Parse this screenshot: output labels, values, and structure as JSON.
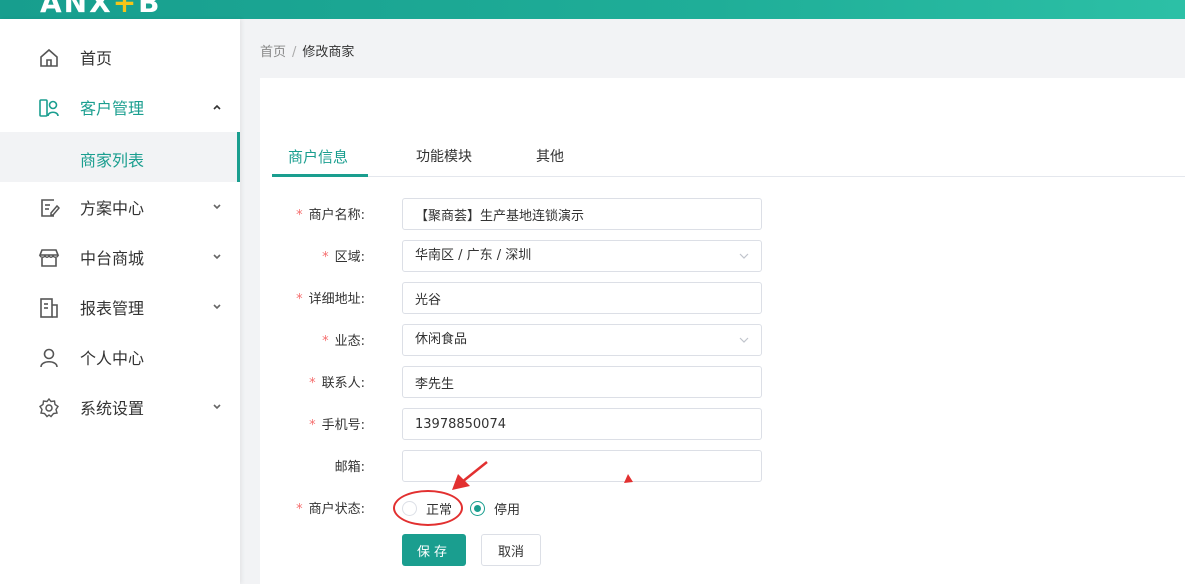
{
  "header": {
    "logo_main": "ANX",
    "logo_plus": "+",
    "logo_tail": "B"
  },
  "sidebar": {
    "items": [
      {
        "label": "首页",
        "icon": "home-icon"
      },
      {
        "label": "客户管理",
        "icon": "customer-icon",
        "expanded": true,
        "children": [
          {
            "label": "商家列表",
            "active": true
          }
        ]
      },
      {
        "label": "方案中心",
        "icon": "plan-icon"
      },
      {
        "label": "中台商城",
        "icon": "store-icon"
      },
      {
        "label": "报表管理",
        "icon": "report-icon"
      },
      {
        "label": "个人中心",
        "icon": "user-icon"
      },
      {
        "label": "系统设置",
        "icon": "settings-icon"
      }
    ]
  },
  "breadcrumb": {
    "home": "首页",
    "separator": "/",
    "current": "修改商家"
  },
  "tabs": [
    {
      "label": "商户信息",
      "active": true
    },
    {
      "label": "功能模块"
    },
    {
      "label": "其他"
    }
  ],
  "form": {
    "merchant_name": {
      "label": "商户名称:",
      "value": "【聚商荟】生产基地连锁演示"
    },
    "region": {
      "label": "区域:",
      "value": "华南区 / 广东 / 深圳"
    },
    "address": {
      "label": "详细地址:",
      "value": "光谷"
    },
    "business_type": {
      "label": "业态:",
      "value": "休闲食品"
    },
    "contact": {
      "label": "联系人:",
      "value": "李先生"
    },
    "phone": {
      "label": "手机号:",
      "value": "13978850074"
    },
    "email": {
      "label": "邮箱:",
      "value": ""
    },
    "status": {
      "label": "商户状态:",
      "options": [
        "正常",
        "停用"
      ],
      "selected": "停用"
    }
  },
  "buttons": {
    "save": "保存",
    "cancel": "取消"
  },
  "colors": {
    "accent": "#1a9e8f",
    "required": "#f56c6c",
    "annotation": "#e23030"
  }
}
